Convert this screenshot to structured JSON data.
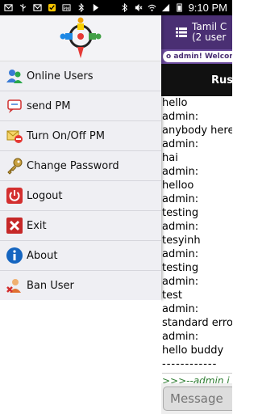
{
  "status_bar": {
    "time": "9:10 PM"
  },
  "chat": {
    "title_line1": "Tamil C",
    "title_line2": "(2 user",
    "welcome": "o admin! Welcom",
    "banner": "Russ",
    "messages": [
      "hello",
      "admin:",
      "anybody here",
      "admin:",
      "hai",
      "admin:",
      "helloo",
      "admin:",
      "testing",
      "admin:",
      "tesyinh",
      "admin:",
      "testing",
      "admin:",
      "test",
      "admin:",
      "standard erro",
      "admin:",
      "hello buddy",
      "------------"
    ],
    "join_notice": ">>>--admin j",
    "input_placeholder": "Message"
  },
  "menu": {
    "items": [
      {
        "label": "Online Users",
        "icon": "users-icon"
      },
      {
        "label": "send PM",
        "icon": "send-pm-icon"
      },
      {
        "label": "Turn On/Off PM",
        "icon": "toggle-pm-icon"
      },
      {
        "label": "Change Password",
        "icon": "key-icon"
      },
      {
        "label": "Logout",
        "icon": "power-icon"
      },
      {
        "label": "Exit",
        "icon": "exit-icon"
      },
      {
        "label": "About",
        "icon": "info-icon"
      },
      {
        "label": "Ban User",
        "icon": "ban-user-icon"
      }
    ]
  },
  "colors": {
    "header": "#4a2f73",
    "welcome_bar": "#6a4a9c",
    "join_notice": "#2e7d32"
  }
}
